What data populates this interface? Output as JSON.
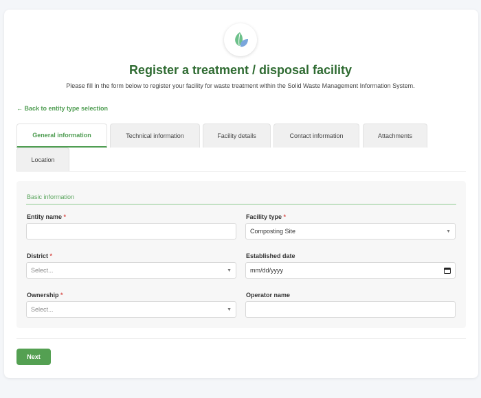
{
  "header": {
    "logo_icon": "leaf-icon",
    "title": "Register a treatment / disposal facility",
    "subtitle": "Please fill in the form below to register your facility for waste treatment within the Solid Waste Management Information System."
  },
  "back_link": "← Back to entity type selection",
  "tabs": [
    {
      "label": "General information",
      "active": true
    },
    {
      "label": "Technical information",
      "active": false
    },
    {
      "label": "Facility details",
      "active": false
    },
    {
      "label": "Contact information",
      "active": false
    },
    {
      "label": "Attachments",
      "active": false
    },
    {
      "label": "Location",
      "active": false
    }
  ],
  "section": {
    "title": "Basic information"
  },
  "fields": {
    "entity_name": {
      "label": "Entity name",
      "required_mark": "*",
      "value": ""
    },
    "facility_type": {
      "label": "Facility type",
      "required_mark": "*",
      "value": "Composting Site"
    },
    "district": {
      "label": "District",
      "required_mark": "*",
      "placeholder": "Select..."
    },
    "established_date": {
      "label": "Established date",
      "placeholder": "mm/dd/yyyy"
    },
    "ownership": {
      "label": "Ownership",
      "required_mark": "*",
      "placeholder": "Select..."
    },
    "operator_name": {
      "label": "Operator name",
      "value": ""
    }
  },
  "actions": {
    "next_label": "Next"
  },
  "colors": {
    "accent": "#4f9d52",
    "title": "#2f6b32",
    "required": "#d9534f",
    "button": "#54a052"
  }
}
